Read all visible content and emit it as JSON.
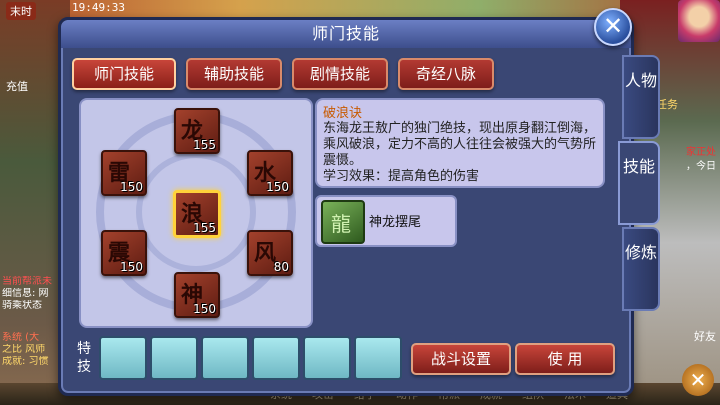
{
  "hud": {
    "clock": "末时",
    "time": "19:49:33",
    "recharge": "充值",
    "chat_lines": [
      "当前帮派未",
      "细信息: 网",
      "骑乘状态",
      "系统 (大",
      "之比  风师",
      "成就: 习惯"
    ],
    "quest": "任务",
    "right_text": [
      "家正处",
      "，今日"
    ],
    "friends": "好友",
    "close_glyph": "✕",
    "bottom_menu": [
      "系统",
      "攻击",
      "给予",
      "动作",
      "帮派",
      "成就",
      "组队",
      "法术",
      "道具"
    ]
  },
  "panel": {
    "title": "师门技能",
    "close_glyph": "✕",
    "tabs": [
      {
        "label": "师门技能",
        "active": true
      },
      {
        "label": "辅助技能",
        "active": false
      },
      {
        "label": "剧情技能",
        "active": false
      },
      {
        "label": "奇经八脉",
        "active": false
      }
    ],
    "side_tabs": [
      {
        "label": "人物",
        "active": false
      },
      {
        "label": "技能",
        "active": true
      },
      {
        "label": "修炼",
        "active": false
      }
    ],
    "skills": [
      {
        "glyph": "龙",
        "level": "155",
        "selected": false
      },
      {
        "glyph": "雷",
        "level": "150",
        "selected": false
      },
      {
        "glyph": "水",
        "level": "150",
        "selected": false
      },
      {
        "glyph": "浪",
        "level": "155",
        "selected": true
      },
      {
        "glyph": "震",
        "level": "150",
        "selected": false
      },
      {
        "glyph": "风",
        "level": "80",
        "selected": false
      },
      {
        "glyph": "神",
        "level": "150",
        "selected": false
      }
    ],
    "description": {
      "name": "破浪诀",
      "text": "东海龙王敖广的独门绝技，现出原身翻江倒海，乘风破浪，定力不高的人往往会被强大的气势所震慑。",
      "effect": "学习效果：提高角色的伤害"
    },
    "sub_skill": {
      "name": "神龙摆尾",
      "glyph": "龍"
    },
    "special_label": "特技",
    "buttons": {
      "battle_settings": "战斗设置",
      "use": "使 用"
    }
  }
}
